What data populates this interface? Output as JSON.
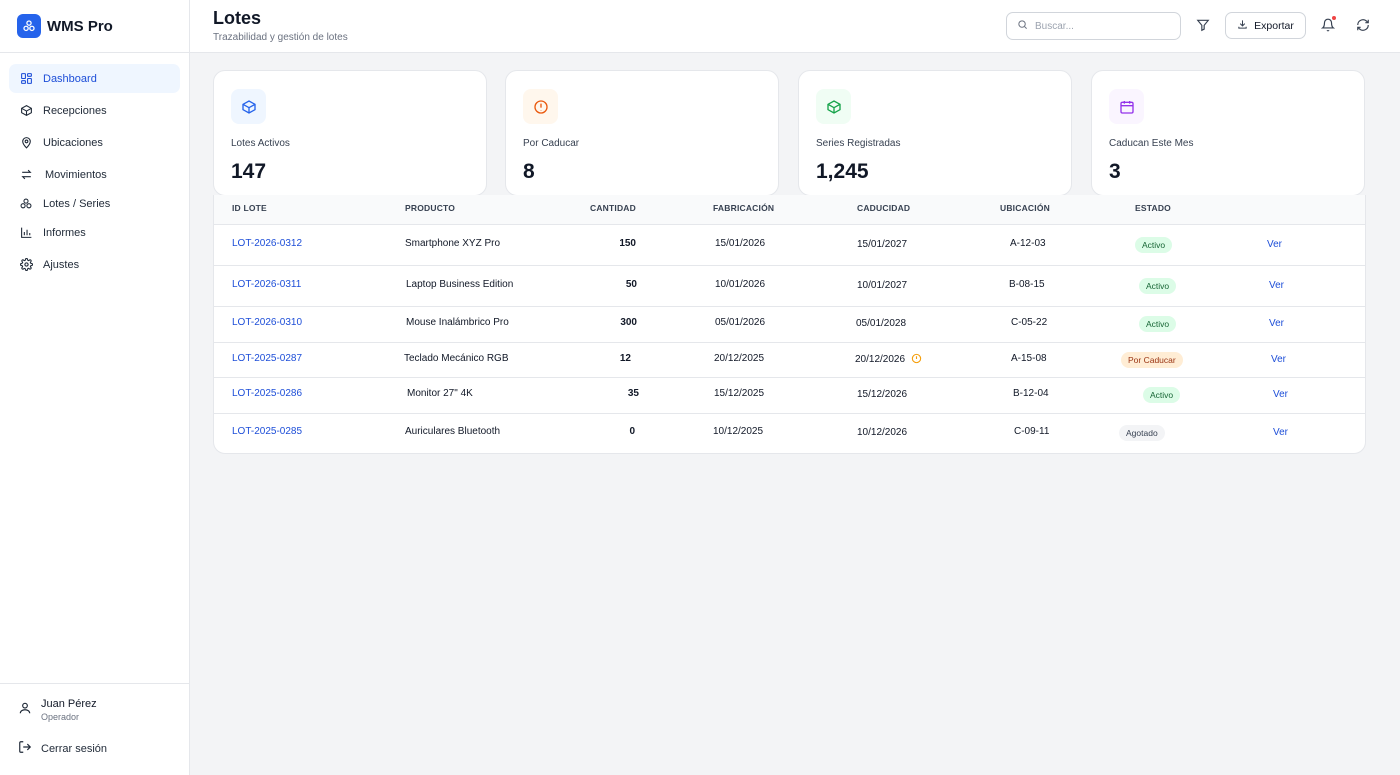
{
  "brand": {
    "name": "WMS Pro"
  },
  "nav": [
    {
      "label": "Dashboard",
      "icon": "dashboard-icon",
      "active": true
    },
    {
      "label": "Recepciones",
      "icon": "box-icon"
    },
    {
      "label": "Ubicaciones",
      "icon": "map-pin-icon"
    },
    {
      "label": "Movimientos",
      "icon": "arrows-icon"
    },
    {
      "label": "Lotes / Series",
      "icon": "boxes-icon"
    },
    {
      "label": "Informes",
      "icon": "chart-icon"
    },
    {
      "label": "Ajustes",
      "icon": "gear-icon"
    }
  ],
  "user": {
    "name": "Juan Pérez",
    "role": "Operador",
    "logout": "Cerrar sesión"
  },
  "header": {
    "title": "Lotes",
    "subtitle": "Trazabilidad y gestión de lotes",
    "search_placeholder": "Buscar...",
    "export_label": "Exportar"
  },
  "stats": [
    {
      "label": "Lotes Activos",
      "value": "147",
      "icon": "box-icon",
      "color": "#2563eb",
      "bg": "#eff6ff"
    },
    {
      "label": "Por Caducar",
      "value": "8",
      "icon": "alert-circle-icon",
      "color": "#ea580c",
      "bg": "#fff7ed"
    },
    {
      "label": "Series Registradas",
      "value": "1,245",
      "icon": "box-icon",
      "color": "#16a34a",
      "bg": "#f0fdf4"
    },
    {
      "label": "Caducan Este Mes",
      "value": "3",
      "icon": "calendar-icon",
      "color": "#9333ea",
      "bg": "#faf5ff"
    }
  ],
  "table": {
    "columns": [
      "ID LOTE",
      "PRODUCTO",
      "CANTIDAD",
      "FABRICACIÓN",
      "CADUCIDAD",
      "UBICACIÓN",
      "ESTADO"
    ],
    "action_label": "Ver",
    "rows": [
      {
        "id": "LOT-2026-0312",
        "product": "Smartphone XYZ Pro",
        "qty": "150",
        "fab": "15/01/2026",
        "cad": "15/01/2027",
        "loc": "A-12-03",
        "status": "Activo",
        "status_kind": "activo",
        "warn": false
      },
      {
        "id": "LOT-2026-0311",
        "product": "Laptop Business Edition",
        "qty": "50",
        "fab": "10/01/2026",
        "cad": "10/01/2027",
        "loc": "B-08-15",
        "status": "Activo",
        "status_kind": "activo",
        "warn": false
      },
      {
        "id": "LOT-2026-0310",
        "product": "Mouse Inalámbrico Pro",
        "qty": "300",
        "fab": "05/01/2026",
        "cad": "05/01/2028",
        "loc": "C-05-22",
        "status": "Activo",
        "status_kind": "activo",
        "warn": false
      },
      {
        "id": "LOT-2025-0287",
        "product": "Teclado Mecánico RGB",
        "qty": "12",
        "fab": "20/12/2025",
        "cad": "20/12/2026",
        "loc": "A-15-08",
        "status": "Por Caducar",
        "status_kind": "por",
        "warn": true
      },
      {
        "id": "LOT-2025-0286",
        "product": "Monitor 27\" 4K",
        "qty": "35",
        "fab": "15/12/2025",
        "cad": "15/12/2026",
        "loc": "B-12-04",
        "status": "Activo",
        "status_kind": "activo",
        "warn": false
      },
      {
        "id": "LOT-2025-0285",
        "product": "Auriculares Bluetooth",
        "qty": "0",
        "fab": "10/12/2025",
        "cad": "10/12/2026",
        "loc": "C-09-11",
        "status": "Agotado",
        "status_kind": "agotado",
        "warn": false
      }
    ]
  }
}
